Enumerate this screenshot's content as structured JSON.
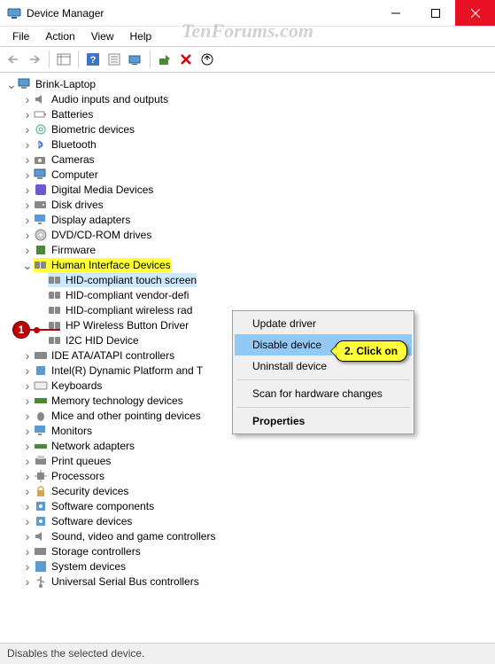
{
  "window": {
    "title": "Device Manager"
  },
  "watermark": "TenForums.com",
  "menubar": [
    "File",
    "Action",
    "View",
    "Help"
  ],
  "statusbar": "Disables the selected device.",
  "tree": {
    "root": "Brink-Laptop",
    "categories": [
      {
        "label": "Audio inputs and outputs",
        "icon": "audio"
      },
      {
        "label": "Batteries",
        "icon": "battery"
      },
      {
        "label": "Biometric devices",
        "icon": "biometric"
      },
      {
        "label": "Bluetooth",
        "icon": "bluetooth"
      },
      {
        "label": "Cameras",
        "icon": "camera"
      },
      {
        "label": "Computer",
        "icon": "computer"
      },
      {
        "label": "Digital Media Devices",
        "icon": "media"
      },
      {
        "label": "Disk drives",
        "icon": "disk"
      },
      {
        "label": "Display adapters",
        "icon": "display"
      },
      {
        "label": "DVD/CD-ROM drives",
        "icon": "optical"
      },
      {
        "label": "Firmware",
        "icon": "firmware"
      }
    ],
    "hid": {
      "label": "Human Interface Devices",
      "children": [
        {
          "label": "HID-compliant touch screen",
          "selected": true
        },
        {
          "label": "HID-compliant vendor-defi"
        },
        {
          "label": "HID-compliant wireless rad"
        },
        {
          "label": "HP Wireless Button Driver"
        },
        {
          "label": "I2C HID Device"
        }
      ]
    },
    "categories2": [
      {
        "label": "IDE ATA/ATAPI controllers",
        "icon": "ide"
      },
      {
        "label": "Intel(R) Dynamic Platform and T",
        "icon": "intel"
      },
      {
        "label": "Keyboards",
        "icon": "keyboard"
      },
      {
        "label": "Memory technology devices",
        "icon": "memory"
      },
      {
        "label": "Mice and other pointing devices",
        "icon": "mouse"
      },
      {
        "label": "Monitors",
        "icon": "monitor"
      },
      {
        "label": "Network adapters",
        "icon": "network"
      },
      {
        "label": "Print queues",
        "icon": "printer"
      },
      {
        "label": "Processors",
        "icon": "cpu"
      },
      {
        "label": "Security devices",
        "icon": "security"
      },
      {
        "label": "Software components",
        "icon": "software"
      },
      {
        "label": "Software devices",
        "icon": "software"
      },
      {
        "label": "Sound, video and game controllers",
        "icon": "sound"
      },
      {
        "label": "Storage controllers",
        "icon": "storage"
      },
      {
        "label": "System devices",
        "icon": "system"
      },
      {
        "label": "Universal Serial Bus controllers",
        "icon": "usb"
      }
    ]
  },
  "context_menu": {
    "items": [
      {
        "label": "Update driver"
      },
      {
        "label": "Disable device",
        "hover": true
      },
      {
        "label": "Uninstall device"
      },
      {
        "separator": true
      },
      {
        "label": "Scan for hardware changes"
      },
      {
        "separator": true
      },
      {
        "label": "Properties",
        "bold": true
      }
    ]
  },
  "callouts": {
    "step1": "1",
    "step2": "2. Click on"
  }
}
